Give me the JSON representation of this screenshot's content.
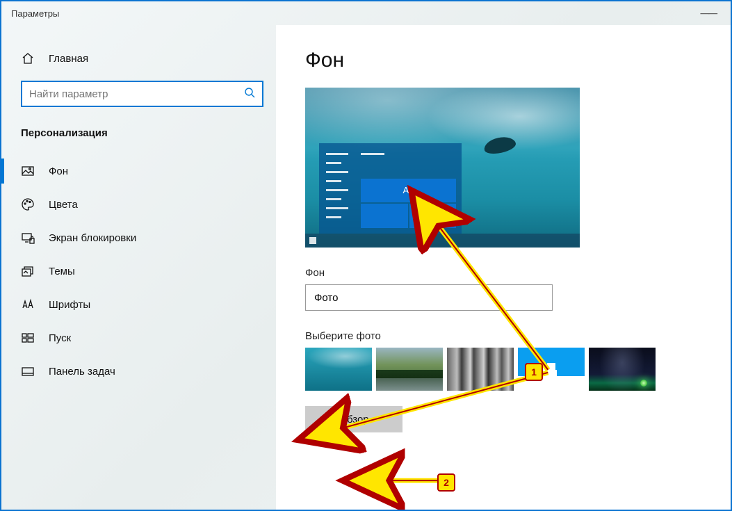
{
  "window": {
    "title": "Параметры"
  },
  "sidebar": {
    "home_label": "Главная",
    "search_placeholder": "Найти параметр",
    "category_label": "Персонализация",
    "items": [
      {
        "label": "Фон"
      },
      {
        "label": "Цвета"
      },
      {
        "label": "Экран блокировки"
      },
      {
        "label": "Темы"
      },
      {
        "label": "Шрифты"
      },
      {
        "label": "Пуск"
      },
      {
        "label": "Панель задач"
      }
    ]
  },
  "main": {
    "heading": "Фон",
    "preview_sample_text": "Aa",
    "background_label": "Фон",
    "background_dropdown_value": "Фото",
    "choose_photo_label": "Выберите фото",
    "browse_button": "Обзор"
  },
  "annotations": {
    "badge1": "1",
    "badge2": "2"
  }
}
